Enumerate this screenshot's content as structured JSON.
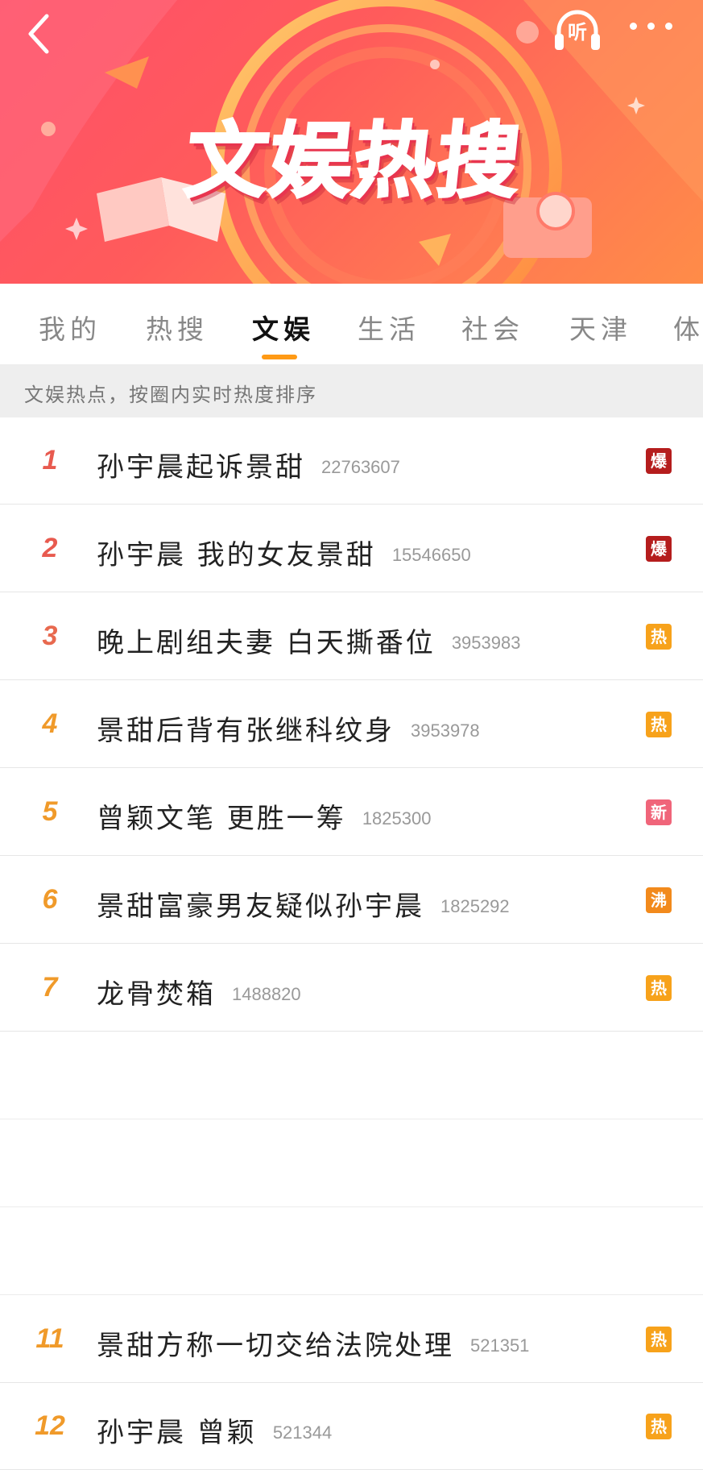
{
  "header": {
    "banner_title": "文娱热搜",
    "listen_label": "听",
    "colors": {
      "gradient_start": "#ff4f6a",
      "gradient_end": "#ff8c48"
    }
  },
  "tabs": [
    {
      "label": "我的"
    },
    {
      "label": "热搜"
    },
    {
      "label": "文娱",
      "active": true
    },
    {
      "label": "生活"
    },
    {
      "label": "社会"
    },
    {
      "label": "天津"
    },
    {
      "label": "体"
    }
  ],
  "subtitle": "文娱热点，按圈内实时热度排序",
  "items": [
    {
      "rank": "1",
      "title": "孙宇晨起诉景甜",
      "count": "22763607",
      "badge": "爆",
      "rank_color": "#e85a4f",
      "badge_color": "#b51d1d"
    },
    {
      "rank": "2",
      "title": "孙宇晨 我的女友景甜",
      "count": "15546650",
      "badge": "爆",
      "rank_color": "#e85a4f",
      "badge_color": "#b51d1d"
    },
    {
      "rank": "3",
      "title": "晚上剧组夫妻 白天撕番位",
      "count": "3953983",
      "badge": "热",
      "rank_color": "#e8694f",
      "badge_color": "#f7a21b"
    },
    {
      "rank": "4",
      "title": "景甜后背有张继科纹身",
      "count": "3953978",
      "badge": "热",
      "rank_color": "#f09a2a",
      "badge_color": "#f7a21b"
    },
    {
      "rank": "5",
      "title": "曾颖文笔 更胜一筹",
      "count": "1825300",
      "badge": "新",
      "rank_color": "#f09a2a",
      "badge_color": "#f0657a"
    },
    {
      "rank": "6",
      "title": "景甜富豪男友疑似孙宇晨",
      "count": "1825292",
      "badge": "沸",
      "rank_color": "#f09a2a",
      "badge_color": "#f28a1c"
    },
    {
      "rank": "7",
      "title": "龙骨焚箱",
      "count": "1488820",
      "badge": "热",
      "rank_color": "#f09a2a",
      "badge_color": "#f7a21b"
    },
    {
      "rank": "11",
      "title": "景甜方称一切交给法院处理",
      "count": "521351",
      "badge": "热",
      "rank_color": "#f09a2a",
      "badge_color": "#f7a21b"
    },
    {
      "rank": "12",
      "title": "孙宇晨 曾颖",
      "count": "521344",
      "badge": "热",
      "rank_color": "#f09a2a",
      "badge_color": "#f7a21b"
    }
  ]
}
